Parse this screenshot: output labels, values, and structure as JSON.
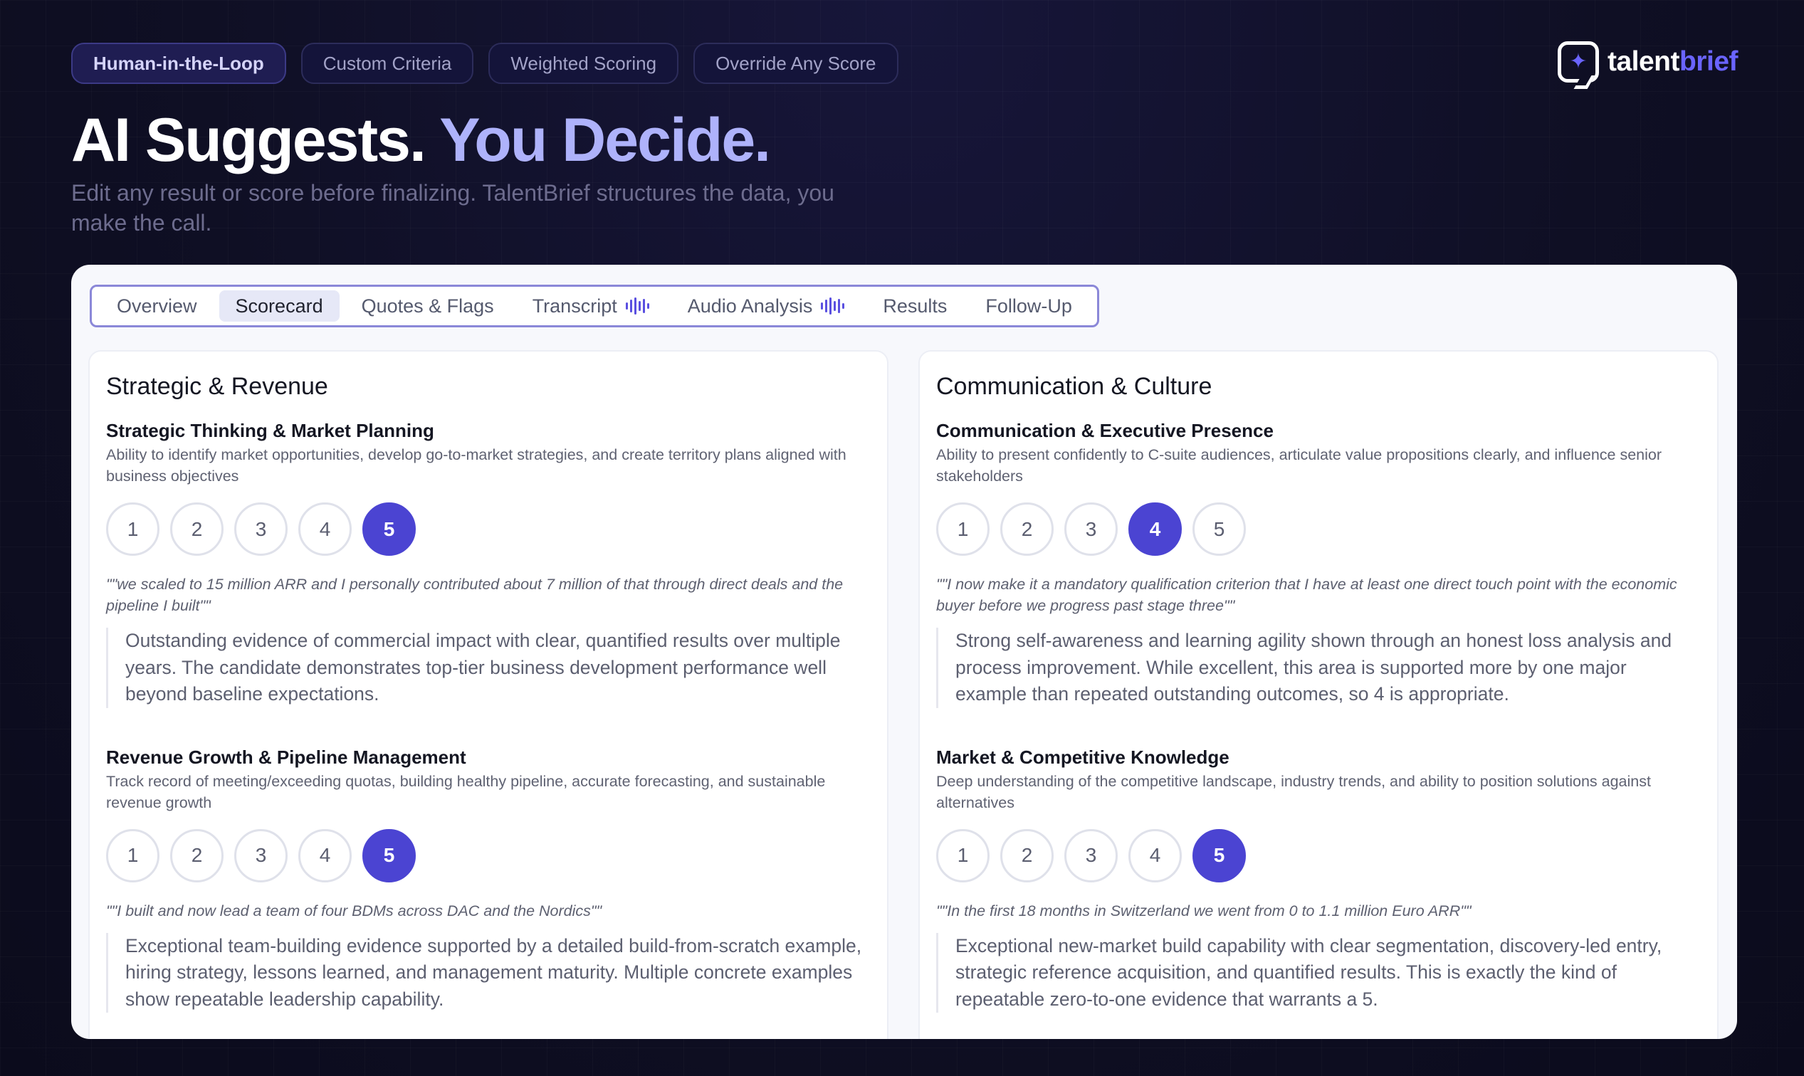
{
  "pills": [
    "Human-in-the-Loop",
    "Custom Criteria",
    "Weighted Scoring",
    "Override Any Score"
  ],
  "logo": {
    "part1": "talent",
    "part2": "brief",
    "icon": "sparkle-chat-icon"
  },
  "headline": {
    "white": "AI Suggests.",
    "accent": "You Decide."
  },
  "subhead": "Edit any result or score before finalizing. TalentBrief structures the data, you make the call.",
  "tabs": [
    {
      "label": "Overview"
    },
    {
      "label": "Scorecard",
      "active": true
    },
    {
      "label": "Quotes & Flags"
    },
    {
      "label": "Transcript",
      "icon": "waveform-icon"
    },
    {
      "label": "Audio Analysis",
      "icon": "waveform-icon"
    },
    {
      "label": "Results"
    },
    {
      "label": "Follow-Up"
    }
  ],
  "columns": [
    {
      "title": "Strategic & Revenue",
      "criteria": [
        {
          "name": "Strategic Thinking & Market Planning",
          "description": "Ability to identify market opportunities, develop go-to-market strategies, and create territory plans aligned with business objectives",
          "score": 5,
          "quote": "\"\"we scaled to 15 million ARR and I personally contributed about 7 million of that through direct deals and the pipeline I built\"\"",
          "rationale": "Outstanding evidence of commercial impact with clear, quantified results over multiple years. The candidate demonstrates top-tier business development performance well beyond baseline expectations."
        },
        {
          "name": "Revenue Growth & Pipeline Management",
          "description": "Track record of meeting/exceeding quotas, building healthy pipeline, accurate forecasting, and sustainable revenue growth",
          "score": 5,
          "quote": "\"\"I built and now lead a team of four BDMs across DAC and the Nordics\"\"",
          "rationale": "Exceptional team-building evidence supported by a detailed build-from-scratch example, hiring strategy, lessons learned, and management maturity. Multiple concrete examples show repeatable leadership capability."
        }
      ]
    },
    {
      "title": "Communication & Culture",
      "criteria": [
        {
          "name": "Communication & Executive Presence",
          "description": "Ability to present confidently to C-suite audiences, articulate value propositions clearly, and influence senior stakeholders",
          "score": 4,
          "quote": "\"\"I now make it a mandatory qualification criterion that I have at least one direct touch point with the economic buyer before we progress past stage three\"\"",
          "rationale": "Strong self-awareness and learning agility shown through an honest loss analysis and process improvement. While excellent, this area is supported more by one major example than repeated outstanding outcomes, so 4 is appropriate."
        },
        {
          "name": "Market & Competitive Knowledge",
          "description": "Deep understanding of the competitive landscape, industry trends, and ability to position solutions against alternatives",
          "score": 5,
          "quote": "\"\"In the first 18 months in Switzerland we went from 0 to 1.1 million Euro ARR\"\"",
          "rationale": "Exceptional new-market build capability with clear segmentation, discovery-led entry, strategic reference acquisition, and quantified results. This is exactly the kind of repeatable zero-to-one evidence that warrants a 5."
        }
      ]
    }
  ],
  "score_scale": [
    "1",
    "2",
    "3",
    "4",
    "5"
  ],
  "colors": {
    "accent": "#4b44d2",
    "headline_accent": "#aeb2fb",
    "background": "#0f0f24"
  }
}
